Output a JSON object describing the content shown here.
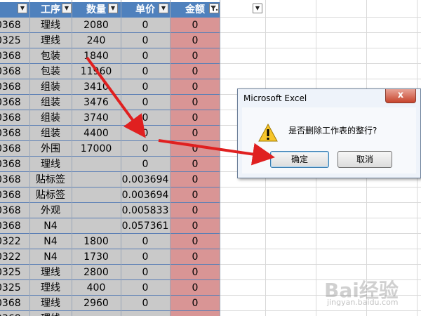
{
  "headers": [
    {
      "label": ""
    },
    {
      "label": "工序"
    },
    {
      "label": "数量"
    },
    {
      "label": "单价"
    },
    {
      "label": "金额"
    }
  ],
  "rows": [
    {
      "id": "0368",
      "proc": "理线",
      "qty": "2080",
      "price": "0",
      "amt": "0"
    },
    {
      "id": "0325",
      "proc": "理线",
      "qty": "240",
      "price": "0",
      "amt": "0"
    },
    {
      "id": "0368",
      "proc": "包装",
      "qty": "1840",
      "price": "0",
      "amt": "0"
    },
    {
      "id": "0368",
      "proc": "包装",
      "qty": "11960",
      "price": "0",
      "amt": "0"
    },
    {
      "id": "0368",
      "proc": "组装",
      "qty": "3410",
      "price": "0",
      "amt": "0"
    },
    {
      "id": "0368",
      "proc": "组装",
      "qty": "3476",
      "price": "0",
      "amt": "0"
    },
    {
      "id": "0368",
      "proc": "组装",
      "qty": "3740",
      "price": "0",
      "amt": "0"
    },
    {
      "id": "0368",
      "proc": "组装",
      "qty": "4400",
      "price": "0",
      "amt": "0"
    },
    {
      "id": "0368",
      "proc": "外围",
      "qty": "17000",
      "price": "0",
      "amt": "0"
    },
    {
      "id": "0368",
      "proc": "理线",
      "qty": "",
      "price": "0",
      "amt": "0"
    },
    {
      "id": "0368",
      "proc": "贴标签",
      "qty": "",
      "price": "0.003694",
      "amt": "0"
    },
    {
      "id": "0368",
      "proc": "贴标签",
      "qty": "",
      "price": "0.003694",
      "amt": "0"
    },
    {
      "id": "0368",
      "proc": "外观",
      "qty": "",
      "price": "0.005833",
      "amt": "0"
    },
    {
      "id": "0368",
      "proc": "N4",
      "qty": "",
      "price": "0.057361",
      "amt": "0"
    },
    {
      "id": "0322",
      "proc": "N4",
      "qty": "1800",
      "price": "0",
      "amt": "0"
    },
    {
      "id": "0322",
      "proc": "N4",
      "qty": "1730",
      "price": "0",
      "amt": "0"
    },
    {
      "id": "0325",
      "proc": "理线",
      "qty": "2800",
      "price": "0",
      "amt": "0"
    },
    {
      "id": "0325",
      "proc": "理线",
      "qty": "400",
      "price": "0",
      "amt": "0"
    },
    {
      "id": "0368",
      "proc": "理线",
      "qty": "2960",
      "price": "0",
      "amt": "0"
    },
    {
      "id": "0368",
      "proc": "理线",
      "qty": "",
      "price": "",
      "amt": ""
    }
  ],
  "dialog": {
    "title": "Microsoft Excel",
    "message": "是否删除工作表的整行?",
    "ok_label": "确定",
    "cancel_label": "取消",
    "close_glyph": "x"
  },
  "watermark": {
    "logo": "Bai经验",
    "url": "jingyan.baidu.com"
  },
  "colors": {
    "header": "#4f81bd",
    "data_cell": "#c9c9c9",
    "amount_cell": "#d99595",
    "arrow": "#e02020"
  }
}
